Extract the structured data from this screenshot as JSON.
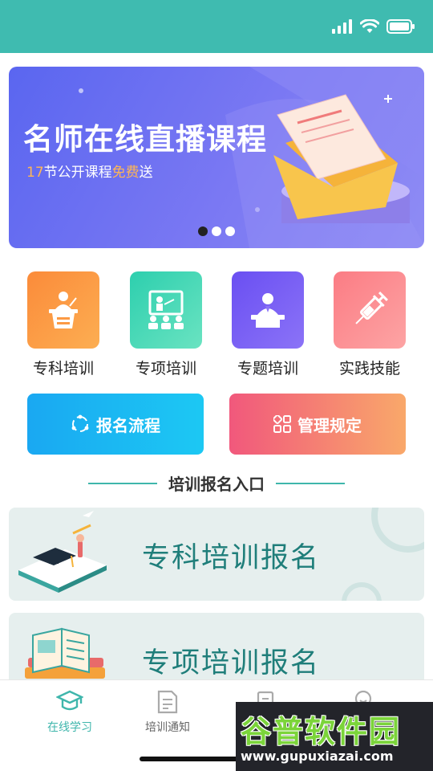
{
  "status_bar": {
    "signal_icon": "signal-bars-icon",
    "wifi_icon": "wifi-icon",
    "battery_icon": "battery-icon"
  },
  "banner": {
    "title": "名师在线直播课程",
    "subtitle_number": "17",
    "subtitle_mid": "节公开课程",
    "subtitle_free": "免费",
    "subtitle_end": "送",
    "pages": 3,
    "active_page": 1
  },
  "categories": [
    {
      "label": "专科培训",
      "icon": "lecturer-podium-icon"
    },
    {
      "label": "专项培训",
      "icon": "classroom-board-icon"
    },
    {
      "label": "专题培训",
      "icon": "speaker-desk-icon"
    },
    {
      "label": "实践技能",
      "icon": "syringe-icon"
    }
  ],
  "actions": {
    "signup": {
      "label": "报名流程",
      "icon": "process-cycle-icon"
    },
    "rules": {
      "label": "管理规定",
      "icon": "grid-apps-icon"
    }
  },
  "section": {
    "title": "培训报名入口"
  },
  "entries": [
    {
      "label": "专科培训报名",
      "icon": "graduation-desk-illustration"
    },
    {
      "label": "专项培训报名",
      "icon": "open-book-illustration"
    }
  ],
  "tabs": [
    {
      "label": "在线学习",
      "icon": "graduation-cap-icon",
      "active": true
    },
    {
      "label": "培训通知",
      "icon": "notice-doc-icon",
      "active": false
    },
    {
      "label": "",
      "icon": "building-icon",
      "active": false
    },
    {
      "label": "",
      "icon": "profile-icon",
      "active": false
    }
  ],
  "watermark": {
    "title": "谷普软件园",
    "url": "www.gupuxiazai.com"
  },
  "colors": {
    "accent": "#3fbbb0",
    "banner": "#5a66f0",
    "signup": "#1aa8f2",
    "rules": "#f1587c",
    "entry_text": "#1f7e7a"
  }
}
